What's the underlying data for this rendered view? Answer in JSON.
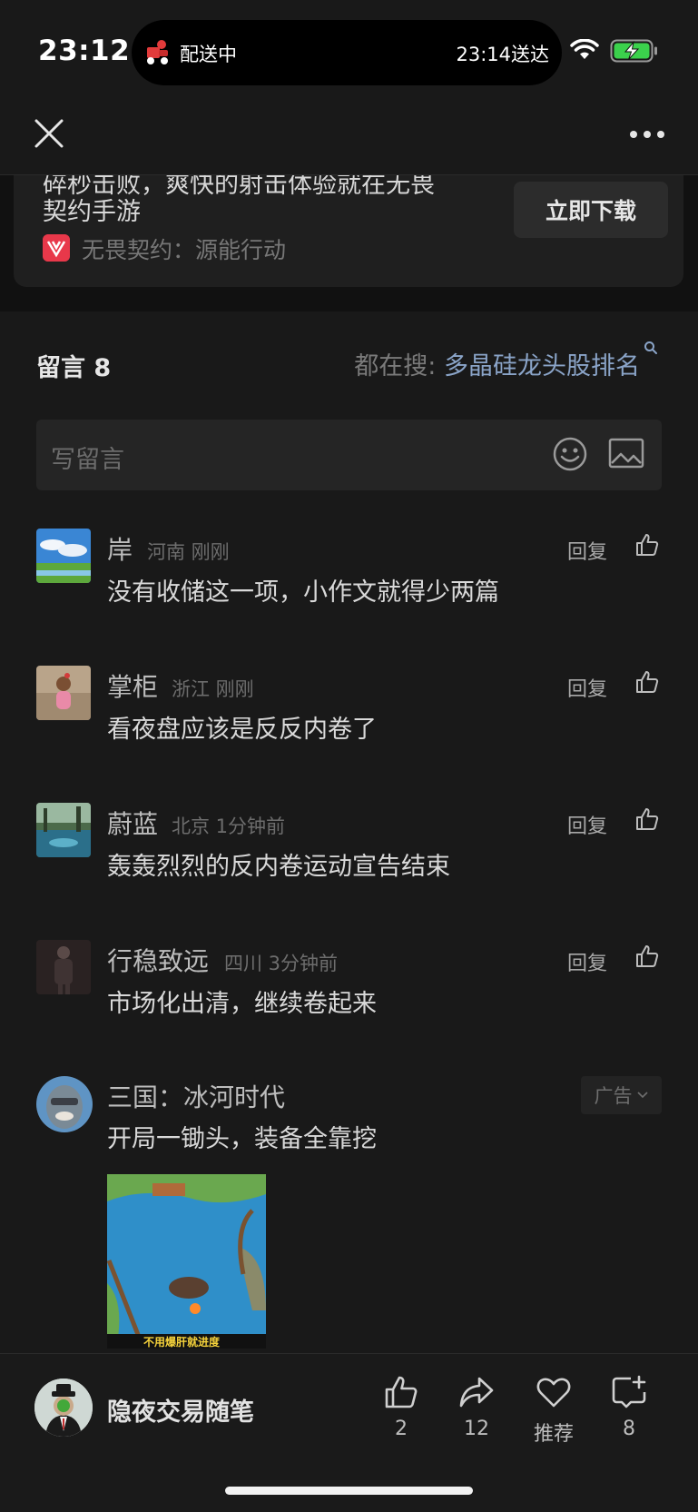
{
  "status_bar": {
    "time": "23:12",
    "delivery_label": "配送中",
    "delivery_eta": "23:14送达"
  },
  "ad_card": {
    "text_cut": "碎秒击败，爽快的射击体验就在无畏",
    "text_line2": "契约手游",
    "brand": "无畏契约：源能行动",
    "download_label": "立即下载"
  },
  "comments_header": {
    "title": "留言 8",
    "search_prefix": "都在搜:",
    "search_keyword": "多晶硅龙头股排名"
  },
  "write_box": {
    "placeholder": "写留言"
  },
  "comments": [
    {
      "name": "岸",
      "meta": "河南 刚刚",
      "text": "没有收储这一项，小作文就得少两篇",
      "reply": "回复"
    },
    {
      "name": "掌柜",
      "meta": "浙江 刚刚",
      "text": "看夜盘应该是反反内卷了",
      "reply": "回复"
    },
    {
      "name": "蔚蓝",
      "meta": "北京 1分钟前",
      "text": "轰轰烈烈的反内卷运动宣告结束",
      "reply": "回复"
    },
    {
      "name": "行稳致远",
      "meta": "四川 3分钟前",
      "text": "市场化出清，继续卷起来",
      "reply": "回复"
    }
  ],
  "ad_comment": {
    "name": "三国：冰河时代",
    "text": "开局一锄头，装备全靠挖",
    "badge": "广告",
    "image_caption": "不用爆肝就进度"
  },
  "bottom_bar": {
    "author": "隐夜交易随笔",
    "like_count": "2",
    "share_count": "12",
    "recommend_label": "推荐",
    "comment_count": "8"
  }
}
